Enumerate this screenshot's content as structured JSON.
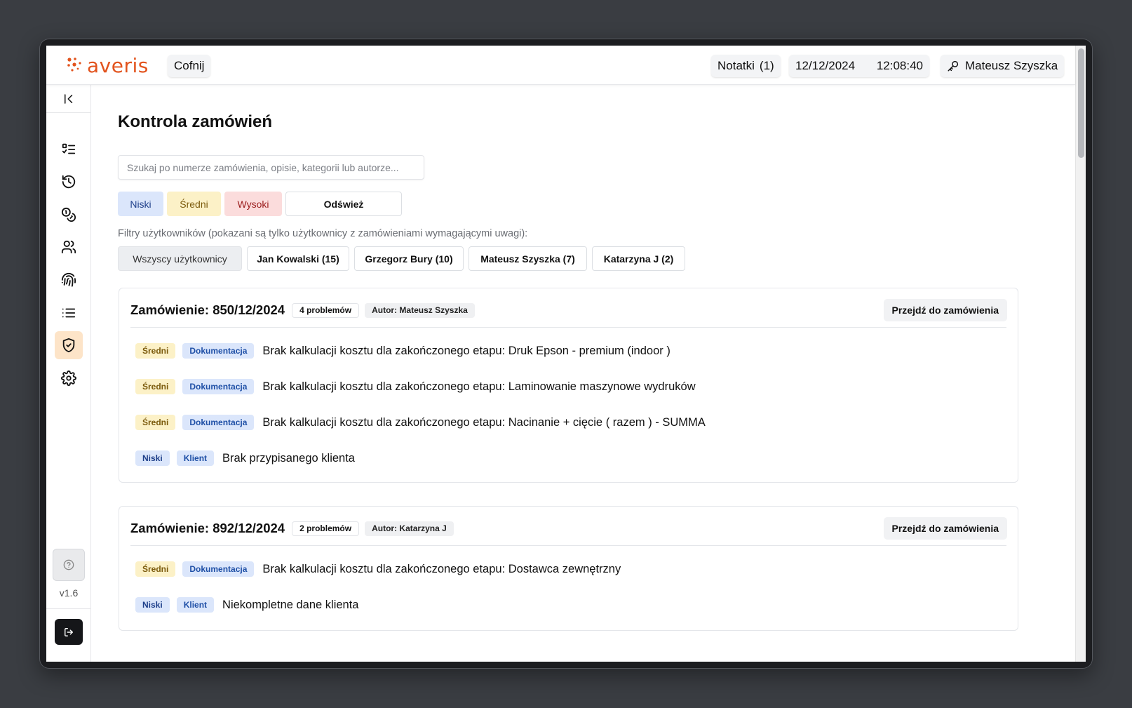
{
  "header": {
    "logo_text": "averis",
    "back_label": "Cofnij",
    "notes_label": "Notatki",
    "notes_count": "(1)",
    "date": "12/12/2024",
    "time": "12:08:40",
    "user_name": "Mateusz Szyszka"
  },
  "sidebar": {
    "items": [
      {
        "icon": "task-list-icon",
        "active": false
      },
      {
        "icon": "history-icon",
        "active": false
      },
      {
        "icon": "coins-icon",
        "active": false
      },
      {
        "icon": "users-icon",
        "active": false
      },
      {
        "icon": "fingerprint-icon",
        "active": false
      },
      {
        "icon": "list-icon",
        "active": false
      },
      {
        "icon": "shield-check-icon",
        "active": true
      },
      {
        "icon": "gear-icon",
        "active": false
      }
    ],
    "version": "v1.6"
  },
  "main": {
    "title": "Kontrola zamówień",
    "search_placeholder": "Szukaj po numerze zamówienia, opisie, kategorii lub autorze...",
    "priority_filters": [
      "Niski",
      "Średni",
      "Wysoki"
    ],
    "refresh_label": "Odśwież",
    "user_filter_caption": "Filtry użytkowników (pokazani są tylko użytkownicy z zamówieniami wymagającymi uwagi):",
    "user_filters": [
      "Wszyscy użytkownicy",
      "Jan Kowalski (15)",
      "Grzegorz Bury (10)",
      "Mateusz Szyszka (7)",
      "Katarzyna J (2)"
    ]
  },
  "orders": [
    {
      "title": "Zamówienie: 850/12/2024",
      "problems": "4 problemów",
      "author": "Autor: Mateusz Szyszka",
      "goto_label": "Przejdź do zamówienia",
      "issues": [
        {
          "priority": "Średni",
          "category": "Dokumentacja",
          "text": "Brak kalkulacji kosztu dla zakończonego etapu: Druk Epson - premium (indoor )"
        },
        {
          "priority": "Średni",
          "category": "Dokumentacja",
          "text": "Brak kalkulacji kosztu dla zakończonego etapu: Laminowanie maszynowe wydruków"
        },
        {
          "priority": "Średni",
          "category": "Dokumentacja",
          "text": "Brak kalkulacji kosztu dla zakończonego etapu: Nacinanie + cięcie ( razem ) - SUMMA"
        },
        {
          "priority": "Niski",
          "category": "Klient",
          "text": "Brak przypisanego klienta"
        }
      ]
    },
    {
      "title": "Zamówienie: 892/12/2024",
      "problems": "2 problemów",
      "author": "Autor: Katarzyna J",
      "goto_label": "Przejdź do zamówienia",
      "issues": [
        {
          "priority": "Średni",
          "category": "Dokumentacja",
          "text": "Brak kalkulacji kosztu dla zakończonego etapu: Dostawca zewnętrzny"
        },
        {
          "priority": "Niski",
          "category": "Klient",
          "text": "Niekompletne dane klienta"
        }
      ]
    }
  ],
  "colors": {
    "brand": "#e2531d",
    "active_nav": "#fde4c8",
    "priority_low": "#dbe6fb",
    "priority_mid": "#fcf1c7",
    "priority_high": "#fbdcdc"
  }
}
